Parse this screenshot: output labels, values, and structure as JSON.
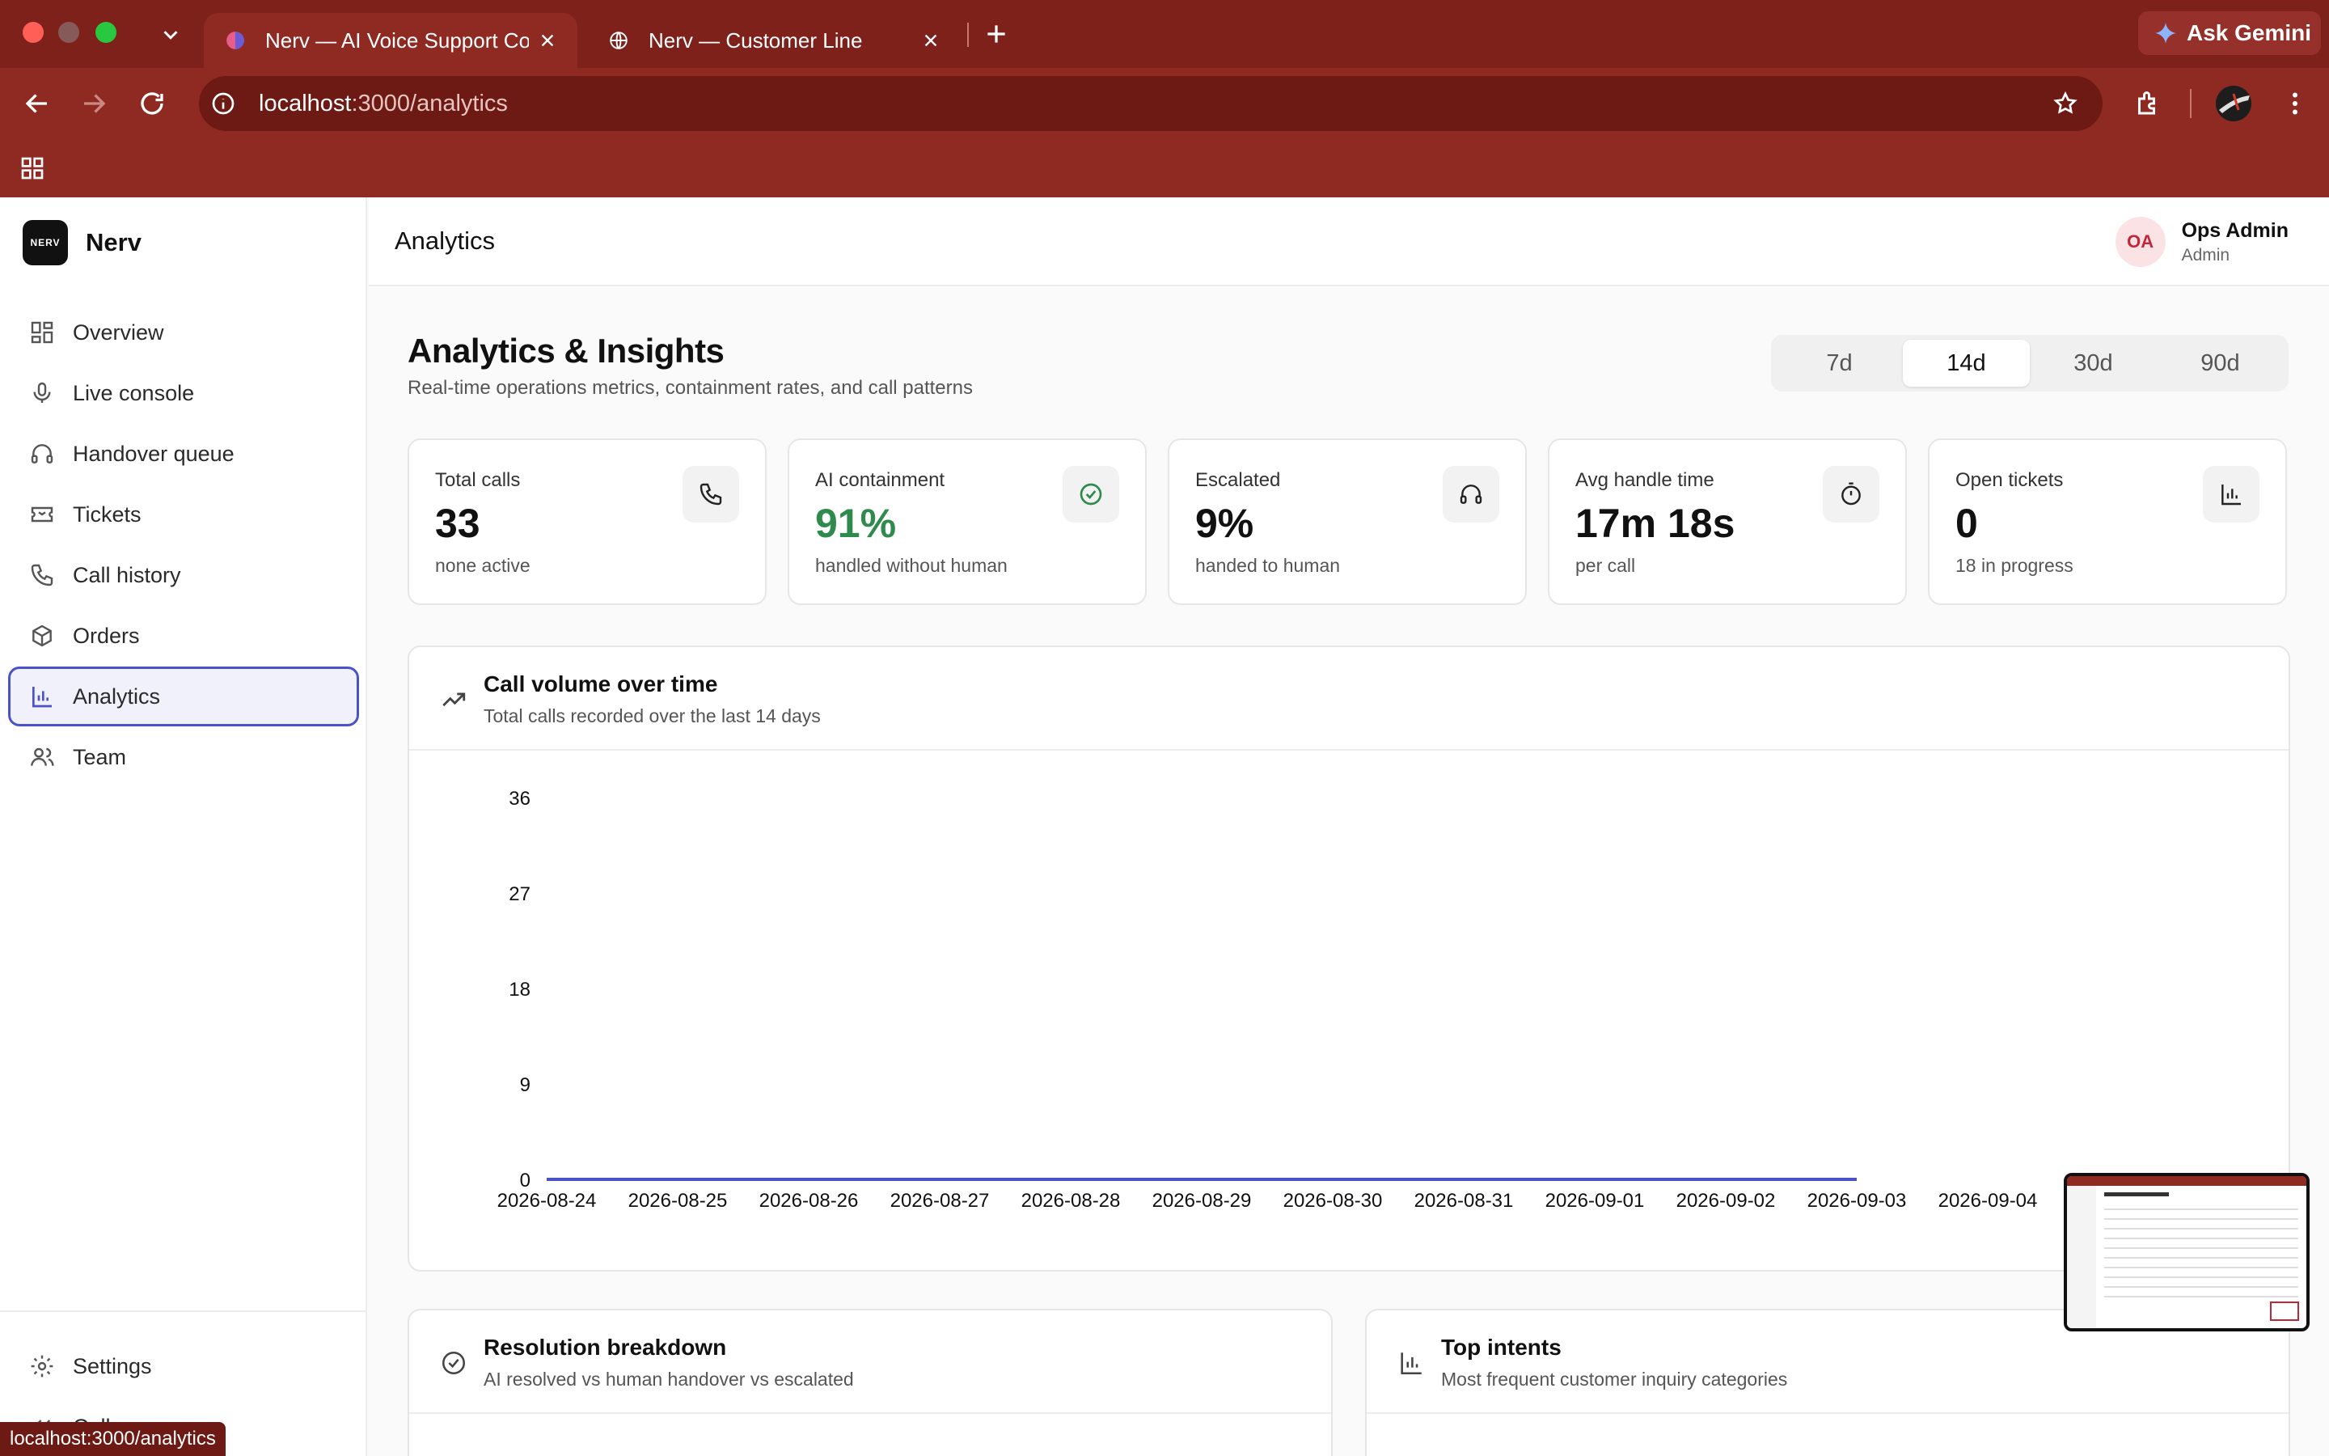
{
  "browser": {
    "tabs": [
      {
        "title": "Nerv — AI Voice Support Con",
        "active": true
      },
      {
        "title": "Nerv — Customer Line",
        "active": false
      }
    ],
    "ask_gemini": "Ask Gemini",
    "url_host": "localhost",
    "url_path": ":3000/analytics",
    "status_url": "localhost:3000/analytics"
  },
  "sidebar": {
    "brand": "Nerv",
    "logo_text": "NERV",
    "items": [
      {
        "label": "Overview",
        "icon": "grid-icon"
      },
      {
        "label": "Live console",
        "icon": "mic-icon"
      },
      {
        "label": "Handover queue",
        "icon": "headphones-icon"
      },
      {
        "label": "Tickets",
        "icon": "ticket-icon"
      },
      {
        "label": "Call history",
        "icon": "phone-icon"
      },
      {
        "label": "Orders",
        "icon": "box-icon"
      },
      {
        "label": "Analytics",
        "icon": "bar-chart-icon",
        "active": true
      },
      {
        "label": "Team",
        "icon": "users-icon"
      }
    ],
    "settings": "Settings",
    "collapse": "Collapse"
  },
  "topbar": {
    "title": "Analytics",
    "user": {
      "initials": "OA",
      "name": "Ops Admin",
      "role": "Admin"
    }
  },
  "page": {
    "heading": "Analytics & Insights",
    "subheading": "Real-time operations metrics, containment rates, and call patterns",
    "ranges": [
      "7d",
      "14d",
      "30d",
      "90d"
    ],
    "selected_range": "14d"
  },
  "kpis": [
    {
      "label": "Total calls",
      "value": "33",
      "note": "none active",
      "icon": "phone-icon"
    },
    {
      "label": "AI containment",
      "value": "91%",
      "note": "handled without human",
      "icon": "check-circle-icon",
      "accent": "#2f8a4e"
    },
    {
      "label": "Escalated",
      "value": "9%",
      "note": "handed to human",
      "icon": "headphones-icon"
    },
    {
      "label": "Avg handle time",
      "value": "17m 18s",
      "note": "per call",
      "icon": "timer-icon"
    },
    {
      "label": "Open tickets",
      "value": "0",
      "note": "18 in progress",
      "icon": "bar-chart-icon"
    }
  ],
  "volume_card": {
    "title": "Call volume over time",
    "subtitle": "Total calls recorded over the last 14 days"
  },
  "resolution_card": {
    "title": "Resolution breakdown",
    "subtitle": "AI resolved vs human handover vs escalated"
  },
  "intents_card": {
    "title": "Top intents",
    "subtitle": "Most frequent customer inquiry categories"
  },
  "chart_data": {
    "type": "line",
    "title": "",
    "xlabel": "",
    "ylabel": "",
    "x": [
      "2026-08-24",
      "2026-08-25",
      "2026-08-26",
      "2026-08-27",
      "2026-08-28",
      "2026-08-29",
      "2026-08-30",
      "2026-08-31",
      "2026-09-01",
      "2026-09-02",
      "2026-09-03",
      "2026-09-04"
    ],
    "values": [
      0,
      0,
      0,
      0,
      0,
      0,
      0,
      0,
      0,
      0,
      0
    ],
    "yticks": [
      "36",
      "27",
      "18",
      "9",
      "0"
    ],
    "ylim": [
      0,
      36
    ],
    "grid": false,
    "line_color": "#4a52c8"
  },
  "colors": {
    "chrome": "#8f2a22",
    "accent": "#4a52c8",
    "success": "#2f8a4e"
  }
}
